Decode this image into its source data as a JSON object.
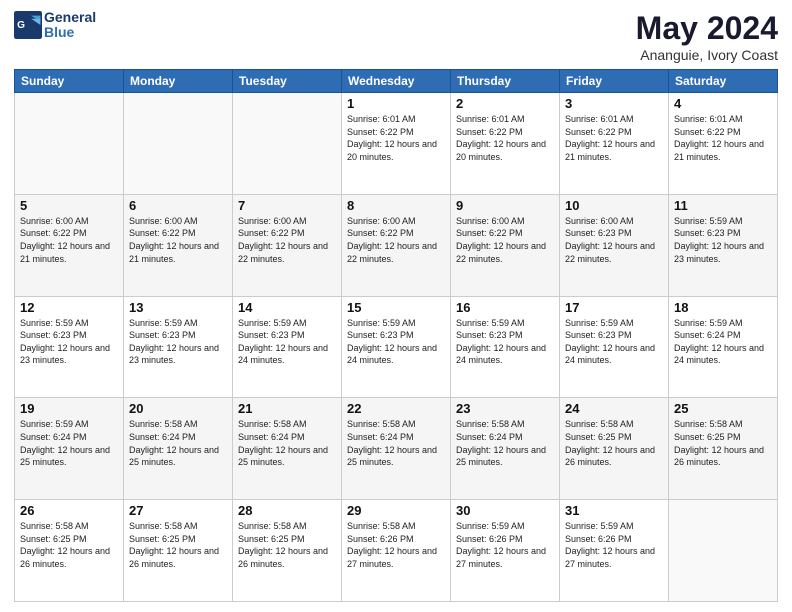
{
  "logo": {
    "line1": "General",
    "line2": "Blue"
  },
  "title": "May 2024",
  "subtitle": "Ananguie, Ivory Coast",
  "days_of_week": [
    "Sunday",
    "Monday",
    "Tuesday",
    "Wednesday",
    "Thursday",
    "Friday",
    "Saturday"
  ],
  "weeks": [
    [
      {
        "day": "",
        "info": ""
      },
      {
        "day": "",
        "info": ""
      },
      {
        "day": "",
        "info": ""
      },
      {
        "day": "1",
        "info": "Sunrise: 6:01 AM\nSunset: 6:22 PM\nDaylight: 12 hours and 20 minutes."
      },
      {
        "day": "2",
        "info": "Sunrise: 6:01 AM\nSunset: 6:22 PM\nDaylight: 12 hours and 20 minutes."
      },
      {
        "day": "3",
        "info": "Sunrise: 6:01 AM\nSunset: 6:22 PM\nDaylight: 12 hours and 21 minutes."
      },
      {
        "day": "4",
        "info": "Sunrise: 6:01 AM\nSunset: 6:22 PM\nDaylight: 12 hours and 21 minutes."
      }
    ],
    [
      {
        "day": "5",
        "info": "Sunrise: 6:00 AM\nSunset: 6:22 PM\nDaylight: 12 hours and 21 minutes."
      },
      {
        "day": "6",
        "info": "Sunrise: 6:00 AM\nSunset: 6:22 PM\nDaylight: 12 hours and 21 minutes."
      },
      {
        "day": "7",
        "info": "Sunrise: 6:00 AM\nSunset: 6:22 PM\nDaylight: 12 hours and 22 minutes."
      },
      {
        "day": "8",
        "info": "Sunrise: 6:00 AM\nSunset: 6:22 PM\nDaylight: 12 hours and 22 minutes."
      },
      {
        "day": "9",
        "info": "Sunrise: 6:00 AM\nSunset: 6:22 PM\nDaylight: 12 hours and 22 minutes."
      },
      {
        "day": "10",
        "info": "Sunrise: 6:00 AM\nSunset: 6:23 PM\nDaylight: 12 hours and 22 minutes."
      },
      {
        "day": "11",
        "info": "Sunrise: 5:59 AM\nSunset: 6:23 PM\nDaylight: 12 hours and 23 minutes."
      }
    ],
    [
      {
        "day": "12",
        "info": "Sunrise: 5:59 AM\nSunset: 6:23 PM\nDaylight: 12 hours and 23 minutes."
      },
      {
        "day": "13",
        "info": "Sunrise: 5:59 AM\nSunset: 6:23 PM\nDaylight: 12 hours and 23 minutes."
      },
      {
        "day": "14",
        "info": "Sunrise: 5:59 AM\nSunset: 6:23 PM\nDaylight: 12 hours and 24 minutes."
      },
      {
        "day": "15",
        "info": "Sunrise: 5:59 AM\nSunset: 6:23 PM\nDaylight: 12 hours and 24 minutes."
      },
      {
        "day": "16",
        "info": "Sunrise: 5:59 AM\nSunset: 6:23 PM\nDaylight: 12 hours and 24 minutes."
      },
      {
        "day": "17",
        "info": "Sunrise: 5:59 AM\nSunset: 6:23 PM\nDaylight: 12 hours and 24 minutes."
      },
      {
        "day": "18",
        "info": "Sunrise: 5:59 AM\nSunset: 6:24 PM\nDaylight: 12 hours and 24 minutes."
      }
    ],
    [
      {
        "day": "19",
        "info": "Sunrise: 5:59 AM\nSunset: 6:24 PM\nDaylight: 12 hours and 25 minutes."
      },
      {
        "day": "20",
        "info": "Sunrise: 5:58 AM\nSunset: 6:24 PM\nDaylight: 12 hours and 25 minutes."
      },
      {
        "day": "21",
        "info": "Sunrise: 5:58 AM\nSunset: 6:24 PM\nDaylight: 12 hours and 25 minutes."
      },
      {
        "day": "22",
        "info": "Sunrise: 5:58 AM\nSunset: 6:24 PM\nDaylight: 12 hours and 25 minutes."
      },
      {
        "day": "23",
        "info": "Sunrise: 5:58 AM\nSunset: 6:24 PM\nDaylight: 12 hours and 25 minutes."
      },
      {
        "day": "24",
        "info": "Sunrise: 5:58 AM\nSunset: 6:25 PM\nDaylight: 12 hours and 26 minutes."
      },
      {
        "day": "25",
        "info": "Sunrise: 5:58 AM\nSunset: 6:25 PM\nDaylight: 12 hours and 26 minutes."
      }
    ],
    [
      {
        "day": "26",
        "info": "Sunrise: 5:58 AM\nSunset: 6:25 PM\nDaylight: 12 hours and 26 minutes."
      },
      {
        "day": "27",
        "info": "Sunrise: 5:58 AM\nSunset: 6:25 PM\nDaylight: 12 hours and 26 minutes."
      },
      {
        "day": "28",
        "info": "Sunrise: 5:58 AM\nSunset: 6:25 PM\nDaylight: 12 hours and 26 minutes."
      },
      {
        "day": "29",
        "info": "Sunrise: 5:58 AM\nSunset: 6:26 PM\nDaylight: 12 hours and 27 minutes."
      },
      {
        "day": "30",
        "info": "Sunrise: 5:59 AM\nSunset: 6:26 PM\nDaylight: 12 hours and 27 minutes."
      },
      {
        "day": "31",
        "info": "Sunrise: 5:59 AM\nSunset: 6:26 PM\nDaylight: 12 hours and 27 minutes."
      },
      {
        "day": "",
        "info": ""
      }
    ]
  ]
}
